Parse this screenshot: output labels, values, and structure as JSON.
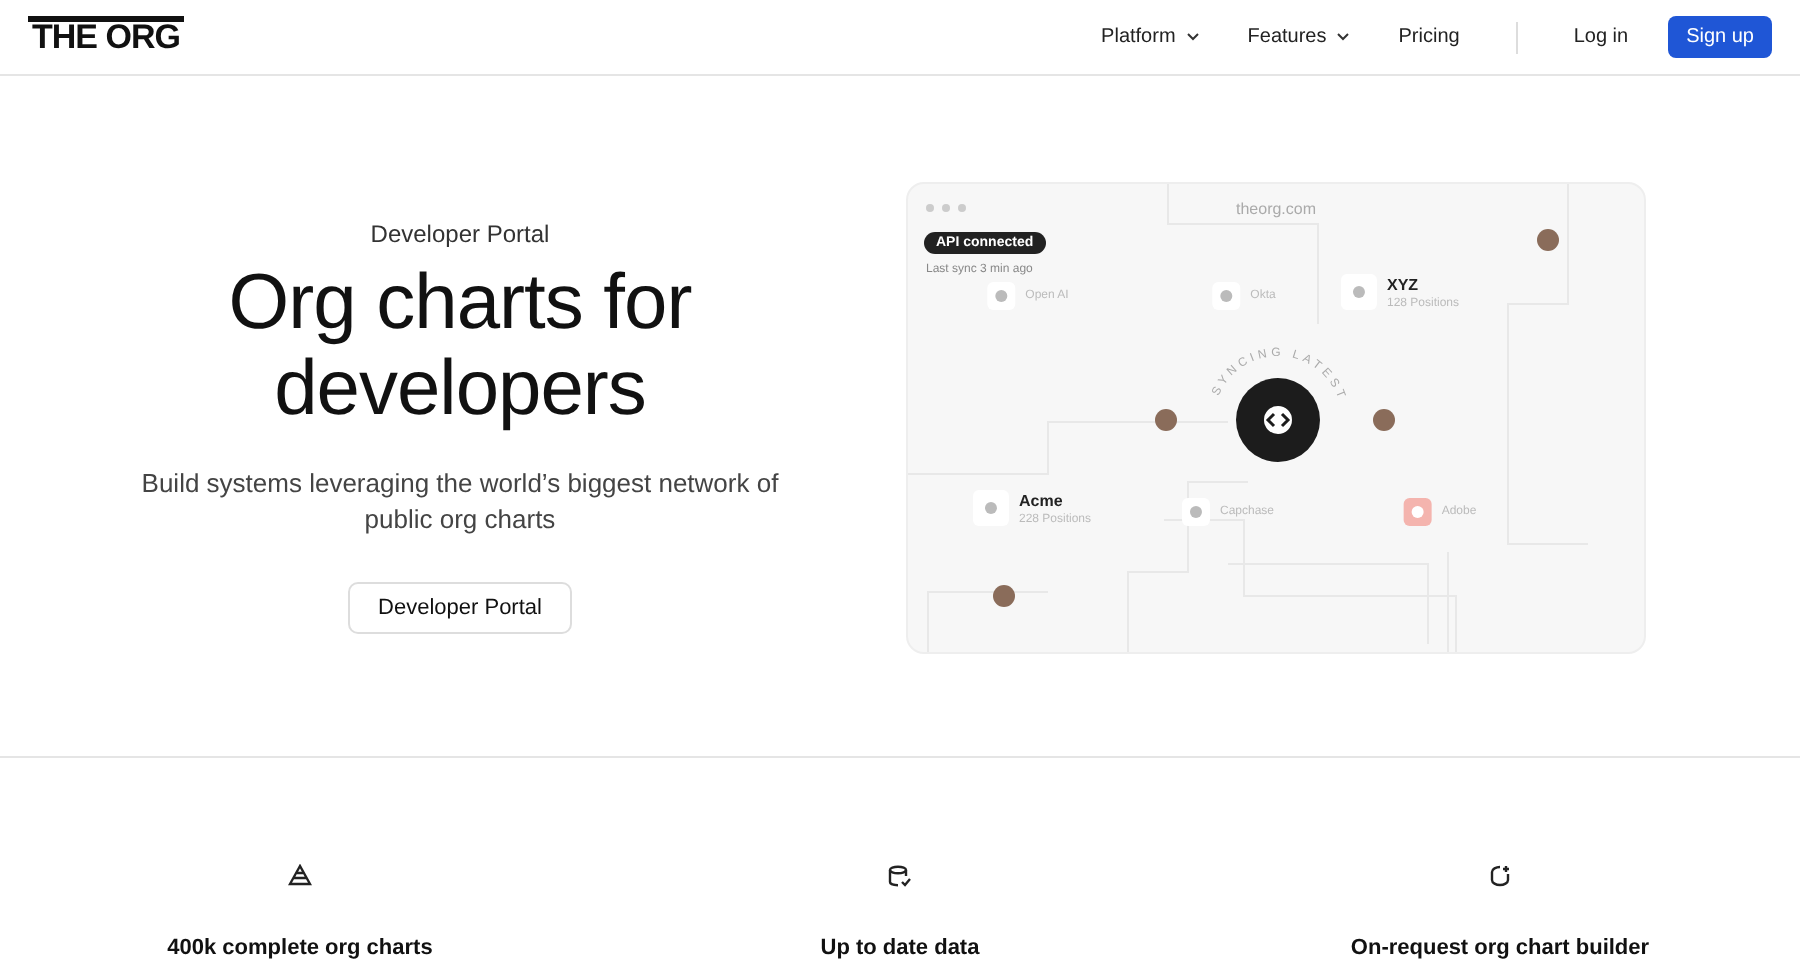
{
  "header": {
    "logo": "THE ORG",
    "nav": [
      {
        "label": "Platform",
        "kind": "dropdown"
      },
      {
        "label": "Features",
        "kind": "dropdown"
      },
      {
        "label": "Pricing",
        "kind": "link"
      }
    ],
    "login": "Log in",
    "signup": "Sign up"
  },
  "hero": {
    "eyebrow": "Developer Portal",
    "title": "Org charts for developers",
    "subtitle": "Build systems leveraging the world’s biggest network of public org charts",
    "cta": "Developer Portal"
  },
  "illustration": {
    "url": "theorg.com",
    "status_badge": "API connected",
    "last_sync": "Last sync 3 min ago",
    "ring_text": "SYNCING LATEST",
    "nodes": [
      {
        "name": "Open AI",
        "kind": "faded"
      },
      {
        "name": "Okta",
        "kind": "faded"
      },
      {
        "name": "XYZ",
        "positions": "128 Positions",
        "kind": "featured"
      },
      {
        "name": "Acme",
        "positions": "228 Positions",
        "kind": "featured"
      },
      {
        "name": "Capchase",
        "kind": "faded"
      },
      {
        "name": "Adobe",
        "kind": "faded",
        "color": "#f4b4ae"
      }
    ]
  },
  "features": [
    {
      "title": "400k complete org charts"
    },
    {
      "title": "Up to date data"
    },
    {
      "title": "On-request org chart builder"
    }
  ]
}
